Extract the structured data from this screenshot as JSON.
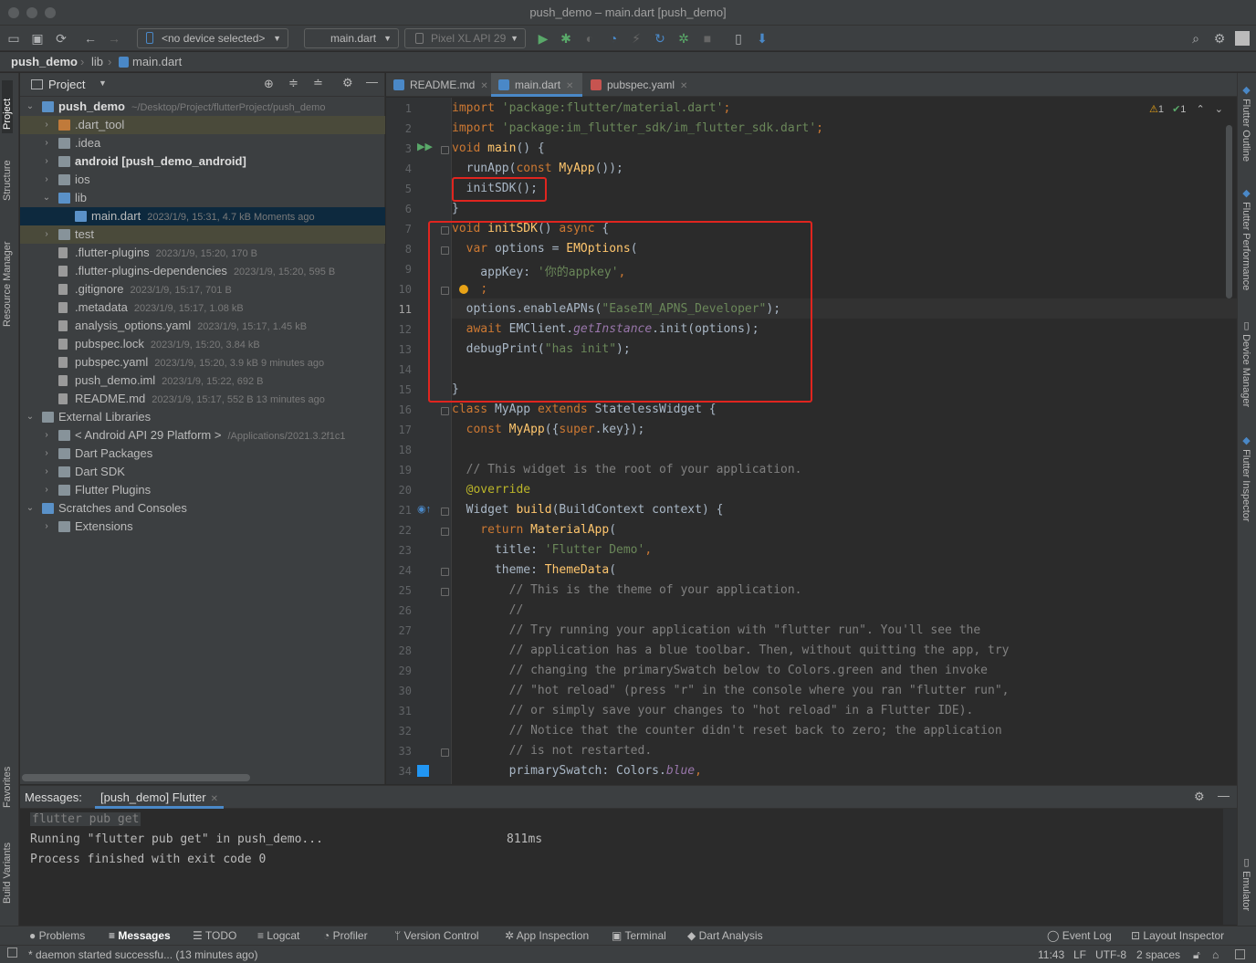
{
  "window": {
    "title": "push_demo – main.dart [push_demo]"
  },
  "toolbar": {
    "device_selector": "<no device selected>",
    "run_config": "main.dart",
    "emulator": "Pixel XL API 29"
  },
  "breadcrumb": [
    "push_demo",
    "lib",
    "main.dart"
  ],
  "left_stripe": {
    "project": "Project",
    "structure": "Structure",
    "resource_manager": "Resource Manager",
    "favorites": "Favorites",
    "build_variants": "Build Variants"
  },
  "right_stripe": {
    "flutter_outline": "Flutter Outline",
    "flutter_performance": "Flutter Performance",
    "device_manager": "Device Manager",
    "flutter_inspector": "Flutter Inspector",
    "emulator": "Emulator"
  },
  "project_panel": {
    "title": "Project",
    "tree": [
      {
        "label": "push_demo",
        "meta": "~/Desktop/Project/flutterProject/push_demo"
      },
      {
        "label": ".dart_tool",
        "meta": ""
      },
      {
        "label": ".idea",
        "meta": ""
      },
      {
        "label": "android [push_demo_android]",
        "meta": ""
      },
      {
        "label": "ios",
        "meta": ""
      },
      {
        "label": "lib",
        "meta": ""
      },
      {
        "label": "main.dart",
        "meta": "2023/1/9, 15:31, 4.7 kB Moments ago"
      },
      {
        "label": "test",
        "meta": ""
      },
      {
        "label": ".flutter-plugins",
        "meta": "2023/1/9, 15:20, 170 B"
      },
      {
        "label": ".flutter-plugins-dependencies",
        "meta": "2023/1/9, 15:20, 595 B"
      },
      {
        "label": ".gitignore",
        "meta": "2023/1/9, 15:17, 701 B"
      },
      {
        "label": ".metadata",
        "meta": "2023/1/9, 15:17, 1.08 kB"
      },
      {
        "label": "analysis_options.yaml",
        "meta": "2023/1/9, 15:17, 1.45 kB"
      },
      {
        "label": "pubspec.lock",
        "meta": "2023/1/9, 15:20, 3.84 kB"
      },
      {
        "label": "pubspec.yaml",
        "meta": "2023/1/9, 15:20, 3.9 kB 9 minutes ago"
      },
      {
        "label": "push_demo.iml",
        "meta": "2023/1/9, 15:22, 692 B"
      },
      {
        "label": "README.md",
        "meta": "2023/1/9, 15:17, 552 B 13 minutes ago"
      },
      {
        "label": "External Libraries",
        "meta": ""
      },
      {
        "label": "< Android API 29 Platform >",
        "meta": "/Applications/2021.3.2f1c1"
      },
      {
        "label": "Dart Packages",
        "meta": ""
      },
      {
        "label": "Dart SDK",
        "meta": ""
      },
      {
        "label": "Flutter Plugins",
        "meta": ""
      },
      {
        "label": "Scratches and Consoles",
        "meta": ""
      },
      {
        "label": "Extensions",
        "meta": ""
      }
    ]
  },
  "editor_tabs": [
    "README.md",
    "main.dart",
    "pubspec.yaml"
  ],
  "inspection": {
    "warnings": "1",
    "ok": "1"
  },
  "code_lines": [
    [
      [
        "kw",
        "import "
      ],
      [
        "str",
        "'package:flutter/material.dart'"
      ],
      [
        "kw",
        ";"
      ]
    ],
    [
      [
        "kw",
        "import "
      ],
      [
        "str",
        "'package:im_flutter_sdk/im_flutter_sdk.dart'"
      ],
      [
        "kw",
        ";"
      ]
    ],
    [
      [
        "kw",
        "void "
      ],
      [
        "fn",
        "main"
      ],
      [
        "plain",
        "() {"
      ]
    ],
    [
      [
        "plain",
        "  runApp("
      ],
      [
        "kw",
        "const "
      ],
      [
        "fn",
        "MyApp"
      ],
      [
        "plain",
        "());"
      ]
    ],
    [
      [
        "plain",
        "  initSDK();"
      ]
    ],
    [
      [
        "plain",
        "}"
      ]
    ],
    [
      [
        "kw",
        "void "
      ],
      [
        "fn",
        "initSDK"
      ],
      [
        "plain",
        "() "
      ],
      [
        "kw",
        "async "
      ],
      [
        "plain",
        "{"
      ]
    ],
    [
      [
        "kw",
        "  var "
      ],
      [
        "plain",
        "options = "
      ],
      [
        "fn",
        "EMOptions"
      ],
      [
        "plain",
        "("
      ]
    ],
    [
      [
        "plain",
        "    appKey: "
      ],
      [
        "str",
        "'你的appkey'"
      ],
      [
        "kw",
        ","
      ]
    ],
    [
      [
        "plain",
        "    "
      ],
      [
        "kw",
        ";"
      ]
    ],
    [
      [
        "plain",
        "  options.enableAPNs("
      ],
      [
        "str",
        "\"EaseIM_APNS_Developer\""
      ],
      [
        "plain",
        ");"
      ]
    ],
    [
      [
        "kw",
        "  await "
      ],
      [
        "plain",
        "EMClient."
      ],
      [
        "it",
        "getInstance"
      ],
      [
        "plain",
        ".init(options);"
      ]
    ],
    [
      [
        "plain",
        "  debugPrint("
      ],
      [
        "str",
        "\"has init\""
      ],
      [
        "plain",
        ");"
      ]
    ],
    [
      [
        "plain",
        ""
      ]
    ],
    [
      [
        "plain",
        "}"
      ]
    ],
    [
      [
        "kw",
        "class "
      ],
      [
        "plain",
        "MyApp "
      ],
      [
        "kw",
        "extends "
      ],
      [
        "plain",
        "StatelessWidget {"
      ]
    ],
    [
      [
        "kw",
        "  const "
      ],
      [
        "fn",
        "MyApp"
      ],
      [
        "plain",
        "({"
      ],
      [
        "kw",
        "super"
      ],
      [
        "plain",
        ".key});"
      ]
    ],
    [
      [
        "plain",
        ""
      ]
    ],
    [
      [
        "cm",
        "  // This widget is the root of your application."
      ]
    ],
    [
      [
        "ann",
        "  @override"
      ]
    ],
    [
      [
        "plain",
        "  Widget "
      ],
      [
        "fn",
        "build"
      ],
      [
        "plain",
        "(BuildContext context) {"
      ]
    ],
    [
      [
        "kw",
        "    return "
      ],
      [
        "fn",
        "MaterialApp"
      ],
      [
        "plain",
        "("
      ]
    ],
    [
      [
        "plain",
        "      title: "
      ],
      [
        "str",
        "'Flutter Demo'"
      ],
      [
        "kw",
        ","
      ]
    ],
    [
      [
        "plain",
        "      theme: "
      ],
      [
        "fn",
        "ThemeData"
      ],
      [
        "plain",
        "("
      ]
    ],
    [
      [
        "cm",
        "        // This is the theme of your application."
      ]
    ],
    [
      [
        "cm",
        "        //"
      ]
    ],
    [
      [
        "cm",
        "        // Try running your application with \"flutter run\". You'll see the"
      ]
    ],
    [
      [
        "cm",
        "        // application has a blue toolbar. Then, without quitting the app, try"
      ]
    ],
    [
      [
        "cm",
        "        // changing the primarySwatch below to Colors.green and then invoke"
      ]
    ],
    [
      [
        "cm",
        "        // \"hot reload\" (press \"r\" in the console where you ran \"flutter run\","
      ]
    ],
    [
      [
        "cm",
        "        // or simply save your changes to \"hot reload\" in a Flutter IDE)."
      ]
    ],
    [
      [
        "cm",
        "        // Notice that the counter didn't reset back to zero; the application"
      ]
    ],
    [
      [
        "cm",
        "        // is not restarted."
      ]
    ],
    [
      [
        "plain",
        "        primarySwatch: Colors."
      ],
      [
        "it",
        "blue"
      ],
      [
        "kw",
        ","
      ]
    ]
  ],
  "messages": {
    "title": "Messages:",
    "tab": "[push_demo] Flutter",
    "lines": [
      "flutter pub get",
      "Running \"flutter pub get\" in push_demo...",
      "Process finished with exit code 0"
    ],
    "timing": "811ms"
  },
  "tool_windows": [
    "Problems",
    "Messages",
    "TODO",
    "Logcat",
    "Profiler",
    "Version Control",
    "App Inspection",
    "Terminal",
    "Dart Analysis",
    "Event Log",
    "Layout Inspector"
  ],
  "status": {
    "message": "* daemon started successfu... (13 minutes ago)",
    "position": "11:43",
    "line_sep": "LF",
    "encoding": "UTF-8",
    "indent": "2 spaces"
  },
  "colors": {
    "accent": "#4a88c7",
    "highlight_box": "#e0251f",
    "run_green": "#59a869"
  }
}
